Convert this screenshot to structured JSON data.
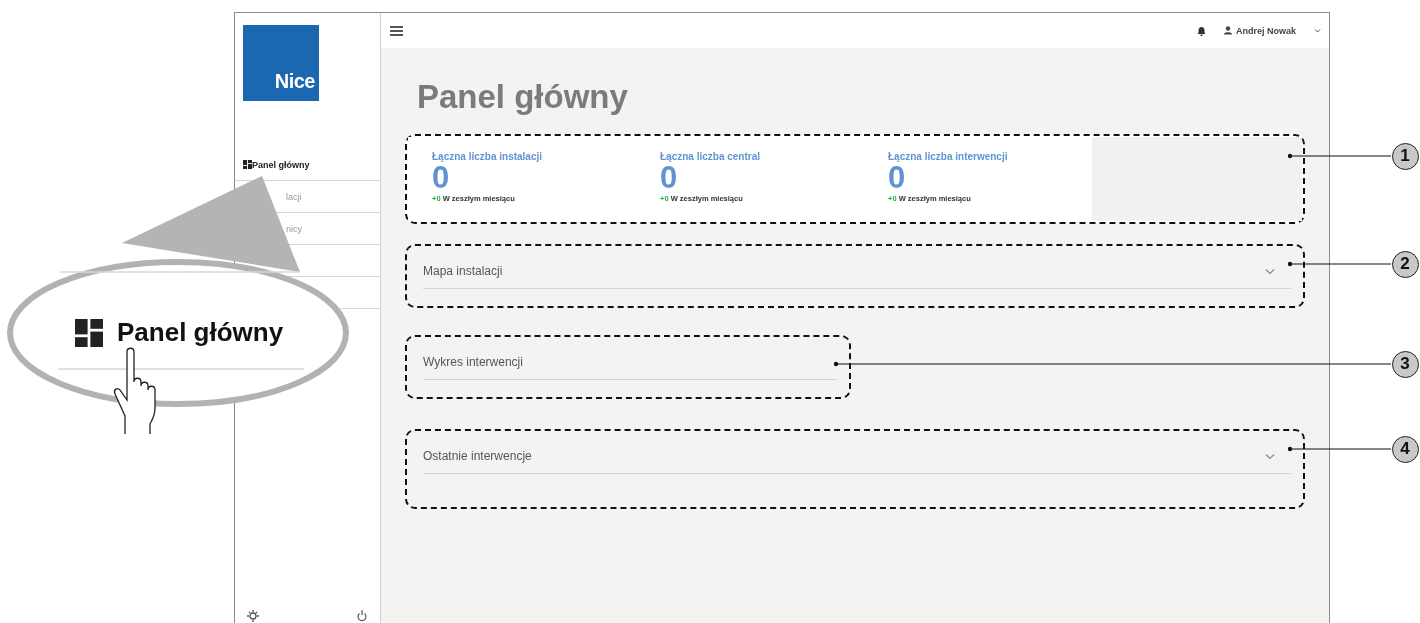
{
  "header": {
    "user": "Andrej Nowak"
  },
  "logo": "Nice",
  "sidebar": {
    "items": [
      {
        "label": "Panel główny",
        "selected": true
      },
      {
        "label": "lacji",
        "selected": false
      },
      {
        "label": "nicy",
        "selected": false
      }
    ]
  },
  "page_title": "Panel główny",
  "stats": {
    "callout": "1",
    "cards": [
      {
        "title": "Łączna liczba instalacji",
        "value": "0",
        "delta": "+0",
        "delta_label": "W zeszłym miesiącu"
      },
      {
        "title": "Łączna liczba central",
        "value": "0",
        "delta": "+0",
        "delta_label": "W zeszłym miesiącu"
      },
      {
        "title": "Łączna liczba interwencji",
        "value": "0",
        "delta": "+0",
        "delta_label": "W zeszłym miesiącu"
      }
    ]
  },
  "panels": [
    {
      "title": "Mapa instalacji",
      "expandable": true,
      "wide": true,
      "callout": "2"
    },
    {
      "title": "Wykres interwencji",
      "expandable": false,
      "wide": false,
      "callout": "3"
    },
    {
      "title": "Ostatnie interwencje",
      "expandable": true,
      "wide": true,
      "callout": "4"
    }
  ],
  "magnifier": {
    "label": "Panel główny"
  }
}
